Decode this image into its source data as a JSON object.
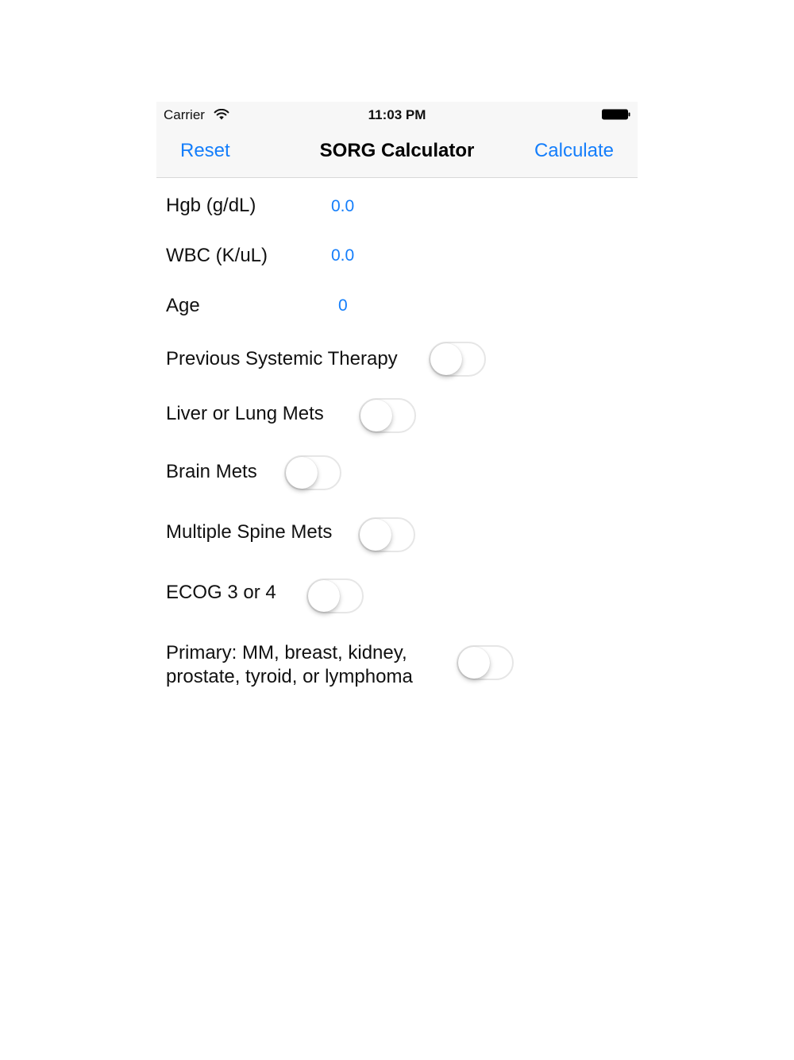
{
  "status_bar": {
    "carrier": "Carrier",
    "time": "11:03 PM",
    "wifi_icon": "wifi-icon",
    "battery_icon": "battery-full-icon"
  },
  "nav": {
    "left_button": "Reset",
    "title": "SORG Calculator",
    "right_button": "Calculate",
    "accent_color": "#147efb"
  },
  "fields": {
    "hgb": {
      "label": "Hgb (g/dL)",
      "value": "0.0"
    },
    "wbc": {
      "label": "WBC (K/uL)",
      "value": "0.0"
    },
    "age": {
      "label": "Age",
      "value": "0"
    }
  },
  "toggles": {
    "previous_systemic_therapy": {
      "label": "Previous Systemic Therapy",
      "on": false
    },
    "liver_or_lung_mets": {
      "label": "Liver or Lung Mets",
      "on": false
    },
    "brain_mets": {
      "label": "Brain Mets",
      "on": false
    },
    "multiple_spine_mets": {
      "label": "Multiple Spine Mets",
      "on": false
    },
    "ecog_3_or_4": {
      "label": "ECOG 3 or 4",
      "on": false
    },
    "primary": {
      "label_line1": "Primary: MM, breast, kidney,",
      "label_line2": "prostate, tyroid, or lymphoma",
      "on": false
    }
  }
}
